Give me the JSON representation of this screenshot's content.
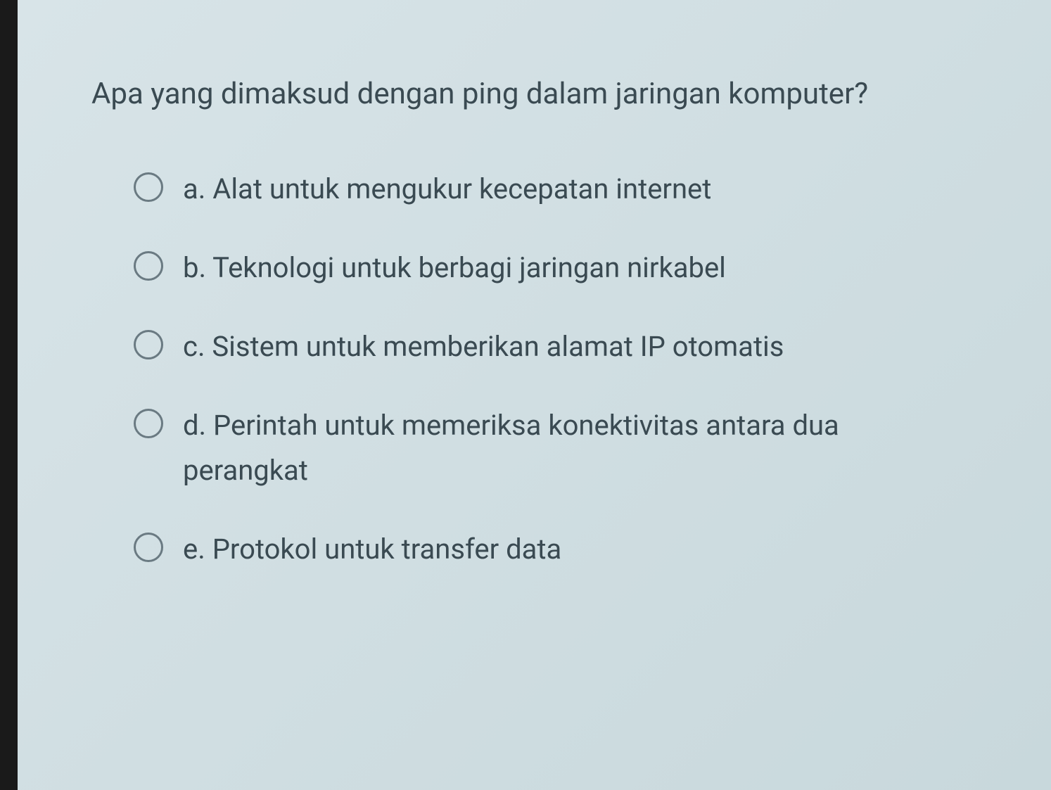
{
  "question": {
    "text": "Apa yang dimaksud dengan ping dalam jaringan komputer?",
    "options": [
      {
        "letter": "a.",
        "text": "Alat untuk mengukur kecepatan internet"
      },
      {
        "letter": "b.",
        "text": "Teknologi untuk berbagi jaringan nirkabel"
      },
      {
        "letter": "c.",
        "text": "Sistem untuk memberikan alamat IP otomatis"
      },
      {
        "letter": "d.",
        "text": "Perintah untuk memeriksa konektivitas antara dua perangkat"
      },
      {
        "letter": "e.",
        "text": "Protokol untuk transfer data"
      }
    ]
  }
}
